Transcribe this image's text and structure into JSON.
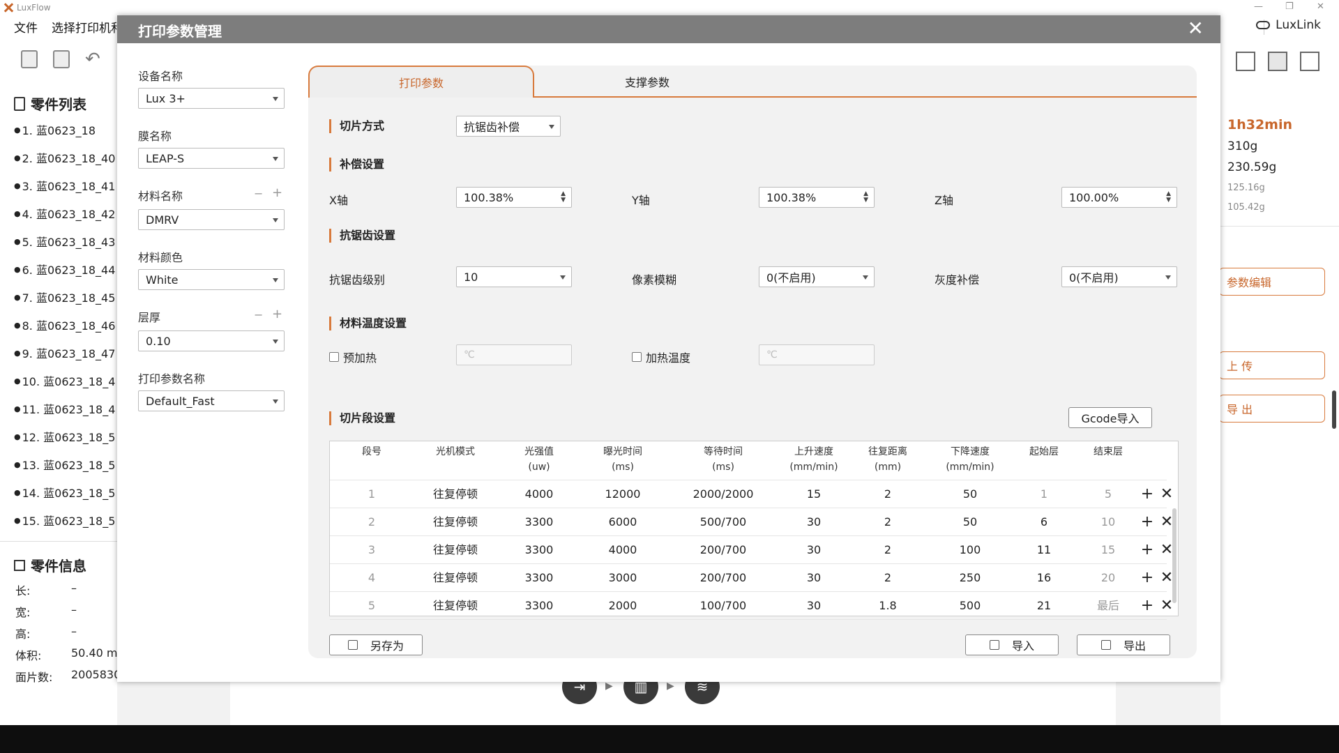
{
  "app": {
    "title": "LuxFlow"
  },
  "menu": {
    "file": "文件",
    "select_printer": "选择打印机和"
  },
  "luxlink": {
    "label": "LuxLink"
  },
  "parts": {
    "header": "零件列表",
    "items": [
      "1. 蓝0623_18",
      "2. 蓝0623_18_40",
      "3. 蓝0623_18_41",
      "4. 蓝0623_18_42",
      "5. 蓝0623_18_43",
      "6. 蓝0623_18_44",
      "7. 蓝0623_18_45",
      "8. 蓝0623_18_46",
      "9. 蓝0623_18_47",
      "10. 蓝0623_18_4",
      "11. 蓝0623_18_4",
      "12. 蓝0623_18_5",
      "13. 蓝0623_18_5",
      "14. 蓝0623_18_5",
      "15. 蓝0623_18_5"
    ]
  },
  "part_info": {
    "header": "零件信息",
    "length_label": "长:",
    "length": "–",
    "width_label": "宽:",
    "width": "–",
    "height_label": "高:",
    "height": "–",
    "volume_label": "体积:",
    "volume": "50.40 m",
    "faces_label": "面片数:",
    "faces": "2005830"
  },
  "right_panel": {
    "time": "1h32min",
    "weight1": "310g",
    "weight2": "230.59g",
    "weight3": "125.16g",
    "weight4": "105.42g",
    "param_edit": "参数编辑",
    "upload": "上 传",
    "export": "导 出"
  },
  "dialog": {
    "title": "打印参数管理",
    "close": "✕",
    "device_label": "设备名称",
    "device_value": "Lux 3+",
    "film_label": "膜名称",
    "film_value": "LEAP-S",
    "material_label": "材料名称",
    "material_value": "DMRV",
    "color_label": "材料颜色",
    "color_value": "White",
    "layer_label": "层厚",
    "layer_value": "0.10",
    "profile_label": "打印参数名称",
    "profile_value": "Default_Fast",
    "minus": "−",
    "plus": "+",
    "tabs": {
      "print": "打印参数",
      "support": "支撑参数"
    },
    "slice_mode_label": "切片方式",
    "slice_mode_value": "抗锯齿补偿",
    "comp_title": "补偿设置",
    "x_label": "X轴",
    "x_value": "100.38%",
    "y_label": "Y轴",
    "y_value": "100.38%",
    "z_label": "Z轴",
    "z_value": "100.00%",
    "aa_title": "抗锯齿设置",
    "aa_level_label": "抗锯齿级别",
    "aa_level_value": "10",
    "blur_label": "像素模糊",
    "blur_value": "0(不启用)",
    "gray_label": "灰度补偿",
    "gray_value": "0(不启用)",
    "temp_title": "材料温度设置",
    "preheat_label": "预加热",
    "preheat_placeholder": "℃",
    "heat_label": "加热温度",
    "heat_placeholder": "℃",
    "segment_title": "切片段设置",
    "gcode_import": "Gcode导入",
    "save_as": "另存为",
    "import": "导入",
    "export": "导出"
  },
  "table": {
    "headers": [
      {
        "l1": "段号",
        "l2": ""
      },
      {
        "l1": "光机模式",
        "l2": ""
      },
      {
        "l1": "光强值",
        "l2": "(uw)"
      },
      {
        "l1": "曝光时间",
        "l2": "(ms)"
      },
      {
        "l1": "等待时间",
        "l2": "(ms)"
      },
      {
        "l1": "上升速度",
        "l2": "(mm/min)"
      },
      {
        "l1": "往复距离",
        "l2": "(mm)"
      },
      {
        "l1": "下降速度",
        "l2": "(mm/min)"
      },
      {
        "l1": "起始层",
        "l2": ""
      },
      {
        "l1": "结束层",
        "l2": ""
      }
    ],
    "rows": [
      [
        "1",
        "往复停顿",
        "4000",
        "12000",
        "2000/2000",
        "15",
        "2",
        "50",
        "1",
        "5"
      ],
      [
        "2",
        "往复停顿",
        "3300",
        "6000",
        "500/700",
        "30",
        "2",
        "50",
        "6",
        "10"
      ],
      [
        "3",
        "往复停顿",
        "3300",
        "4000",
        "200/700",
        "30",
        "2",
        "100",
        "11",
        "15"
      ],
      [
        "4",
        "往复停顿",
        "3300",
        "3000",
        "200/700",
        "30",
        "2",
        "250",
        "16",
        "20"
      ],
      [
        "5",
        "往复停顿",
        "3300",
        "2000",
        "100/700",
        "30",
        "1.8",
        "500",
        "21",
        "最后"
      ]
    ],
    "add_symbol": "+",
    "delete_symbol": "✕"
  },
  "colors": {
    "accent": "#d87a3c",
    "header_bg": "#7d7d7d"
  }
}
